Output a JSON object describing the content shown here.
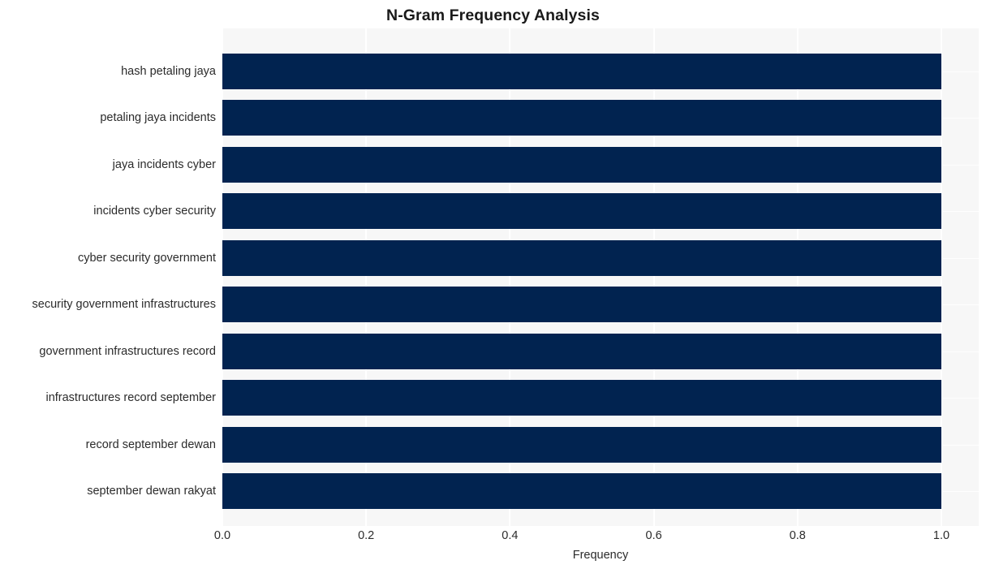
{
  "chart_data": {
    "type": "bar",
    "orientation": "horizontal",
    "title": "N-Gram Frequency Analysis",
    "xlabel": "Frequency",
    "ylabel": "",
    "categories": [
      "hash petaling jaya",
      "petaling jaya incidents",
      "jaya incidents cyber",
      "incidents cyber security",
      "cyber security government",
      "security government infrastructures",
      "government infrastructures record",
      "infrastructures record september",
      "record september dewan",
      "september dewan rakyat"
    ],
    "values": [
      1.0,
      1.0,
      1.0,
      1.0,
      1.0,
      1.0,
      1.0,
      1.0,
      1.0,
      1.0
    ],
    "xlim": [
      0.0,
      1.0
    ],
    "xticks": [
      "0.0",
      "0.2",
      "0.4",
      "0.6",
      "0.8",
      "1.0"
    ],
    "xtick_values": [
      0.0,
      0.2,
      0.4,
      0.6,
      0.8,
      1.0
    ],
    "grid": true,
    "legend": false,
    "bar_color": "#012350",
    "plot_background": "#f7f7f7",
    "figure_background": "#ffffff",
    "gridline_color": "#ffffff",
    "text_color": "#2b2b2b",
    "title_color": "#1a1a1a"
  }
}
